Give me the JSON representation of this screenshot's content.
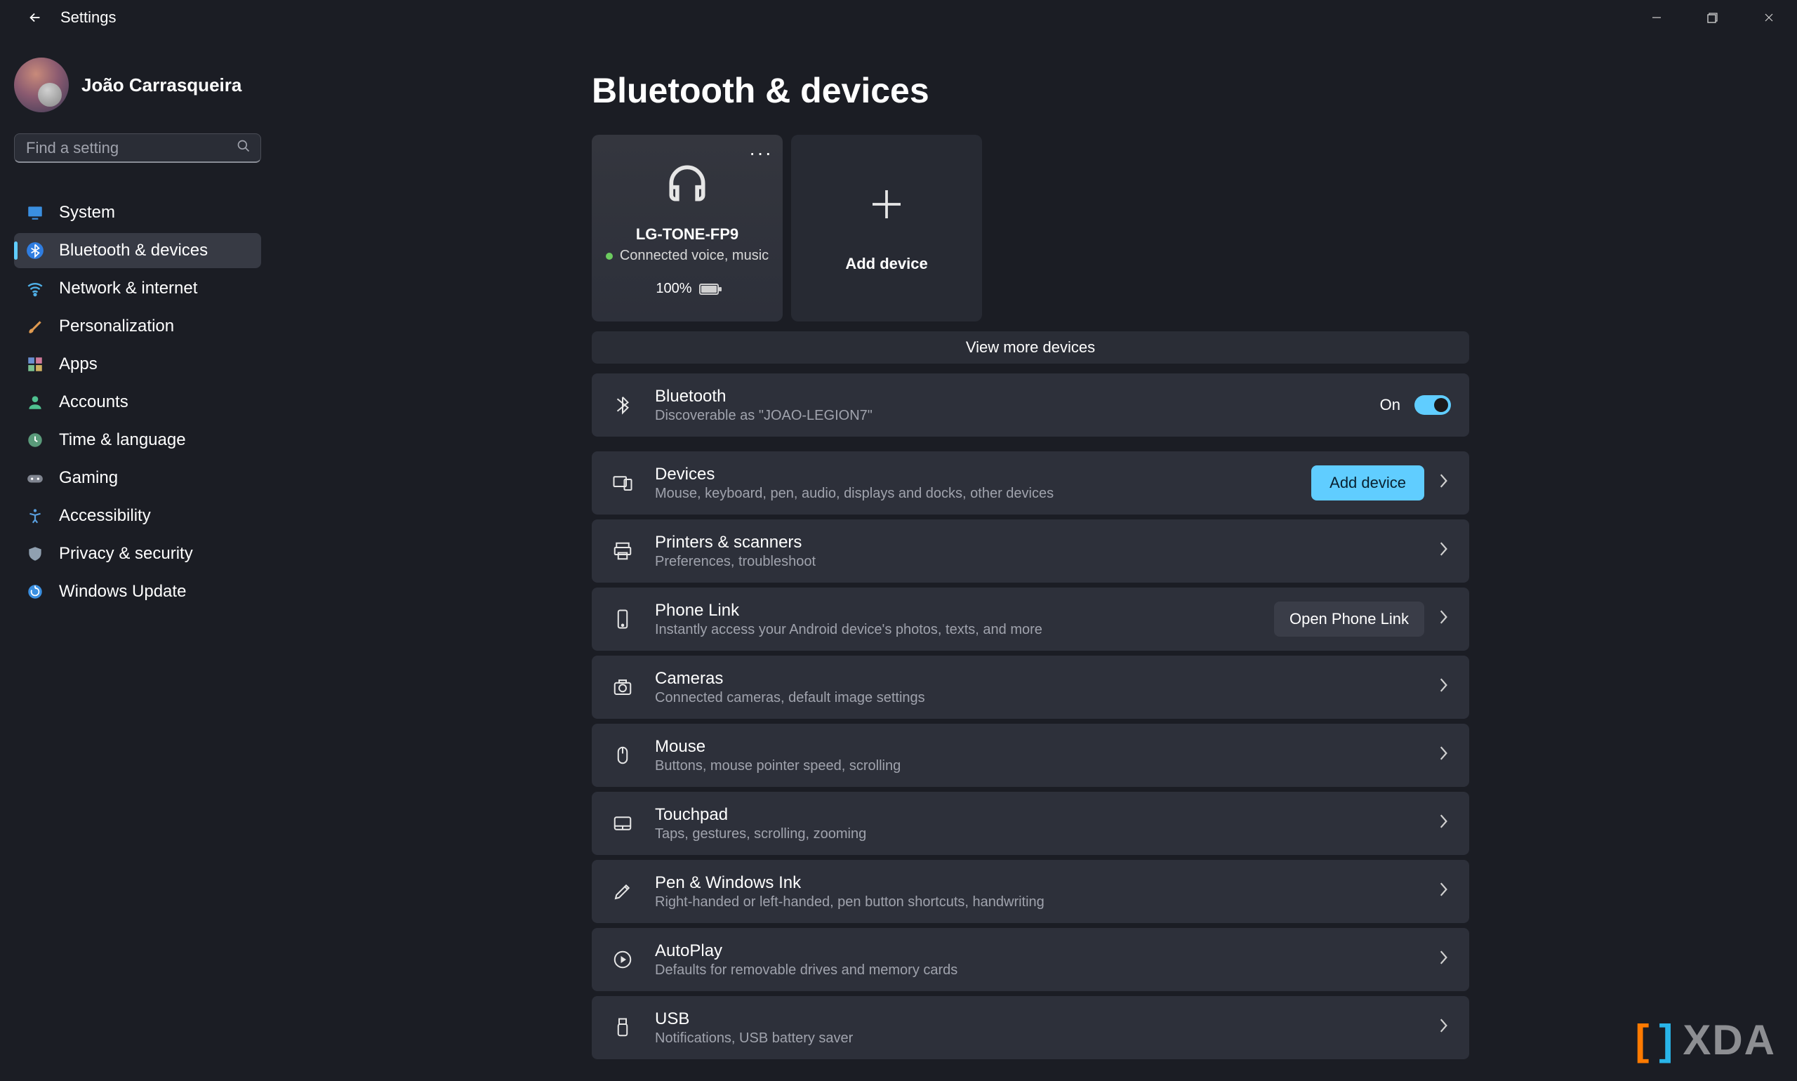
{
  "window": {
    "title": "Settings"
  },
  "user": {
    "name": "João Carrasqueira"
  },
  "search": {
    "placeholder": "Find a setting"
  },
  "sidebar": {
    "items": [
      {
        "label": "System"
      },
      {
        "label": "Bluetooth & devices"
      },
      {
        "label": "Network & internet"
      },
      {
        "label": "Personalization"
      },
      {
        "label": "Apps"
      },
      {
        "label": "Accounts"
      },
      {
        "label": "Time & language"
      },
      {
        "label": "Gaming"
      },
      {
        "label": "Accessibility"
      },
      {
        "label": "Privacy & security"
      },
      {
        "label": "Windows Update"
      }
    ],
    "selected_index": 1
  },
  "page": {
    "title": "Bluetooth & devices"
  },
  "device_card": {
    "name": "LG-TONE-FP9",
    "status": "Connected voice, music",
    "battery": "100%"
  },
  "add_card": {
    "label": "Add device"
  },
  "view_more": "View more devices",
  "bluetooth_row": {
    "title": "Bluetooth",
    "sub": "Discoverable as \"JOAO-LEGION7\"",
    "state_label": "On",
    "state_on": true
  },
  "rows": {
    "devices": {
      "title": "Devices",
      "sub": "Mouse, keyboard, pen, audio, displays and docks, other devices",
      "button": "Add device"
    },
    "printers": {
      "title": "Printers & scanners",
      "sub": "Preferences, troubleshoot"
    },
    "phone": {
      "title": "Phone Link",
      "sub": "Instantly access your Android device's photos, texts, and more",
      "button": "Open Phone Link"
    },
    "cameras": {
      "title": "Cameras",
      "sub": "Connected cameras, default image settings"
    },
    "mouse": {
      "title": "Mouse",
      "sub": "Buttons, mouse pointer speed, scrolling"
    },
    "touchpad": {
      "title": "Touchpad",
      "sub": "Taps, gestures, scrolling, zooming"
    },
    "pen": {
      "title": "Pen & Windows Ink",
      "sub": "Right-handed or left-handed, pen button shortcuts, handwriting"
    },
    "autoplay": {
      "title": "AutoPlay",
      "sub": "Defaults for removable drives and memory cards"
    },
    "usb": {
      "title": "USB",
      "sub": "Notifications, USB battery saver"
    }
  },
  "watermark": "XDA"
}
